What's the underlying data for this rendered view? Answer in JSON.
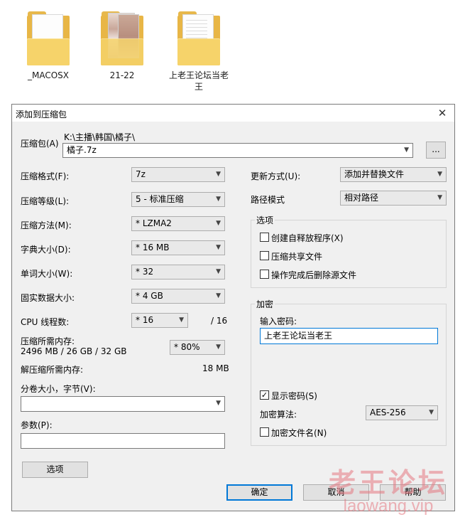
{
  "desktop": {
    "folders": [
      {
        "label": "_MACOSX"
      },
      {
        "label": "21-22"
      },
      {
        "label": "上老王论坛当老王"
      }
    ]
  },
  "dialog": {
    "title": "添加到压缩包",
    "close": "✕",
    "archive": {
      "label": "压缩包(A)",
      "path": "K:\\主播\\韩国\\橘子\\",
      "filename": "橘子.7z",
      "browse": "..."
    },
    "left": {
      "format": {
        "label": "压缩格式(F):",
        "value": "7z"
      },
      "level": {
        "label": "压缩等级(L):",
        "value": "5 - 标准压缩"
      },
      "method": {
        "label": "压缩方法(M):",
        "value": "* LZMA2"
      },
      "dict": {
        "label": "字典大小(D):",
        "value": "* 16 MB"
      },
      "word": {
        "label": "单词大小(W):",
        "value": "* 32"
      },
      "solid": {
        "label": "固实数据大小:",
        "value": "* 4 GB"
      },
      "threads": {
        "label": "CPU 线程数:",
        "value": "* 16",
        "max": "/ 16"
      },
      "memory": {
        "label": "压缩所需内存:",
        "detail": "2496 MB / 26 GB / 32 GB",
        "value": "* 80%"
      },
      "decomp": {
        "label": "解压缩所需内存:",
        "value": "18 MB"
      },
      "split": {
        "label": "分卷大小，字节(V):",
        "value": ""
      },
      "params": {
        "label": "参数(P):",
        "value": ""
      },
      "options_button": "选项"
    },
    "right": {
      "update": {
        "label": "更新方式(U):",
        "value": "添加并替换文件"
      },
      "pathmode": {
        "label": "路径模式",
        "value": "相对路径"
      },
      "options": {
        "title": "选项",
        "sfx": "创建自释放程序(X)",
        "shared": "压缩共享文件",
        "delete": "操作完成后删除源文件"
      },
      "encryption": {
        "title": "加密",
        "pwd_label": "输入密码:",
        "pwd_value": "上老王论坛当老王",
        "show": "显示密码(S)",
        "method_label": "加密算法:",
        "method_value": "AES-256",
        "encnames": "加密文件名(N)"
      }
    },
    "buttons": {
      "ok": "确定",
      "cancel": "取消",
      "help": "帮助"
    }
  },
  "watermark": {
    "cn": "老王论坛",
    "url": "laowang.vip"
  }
}
